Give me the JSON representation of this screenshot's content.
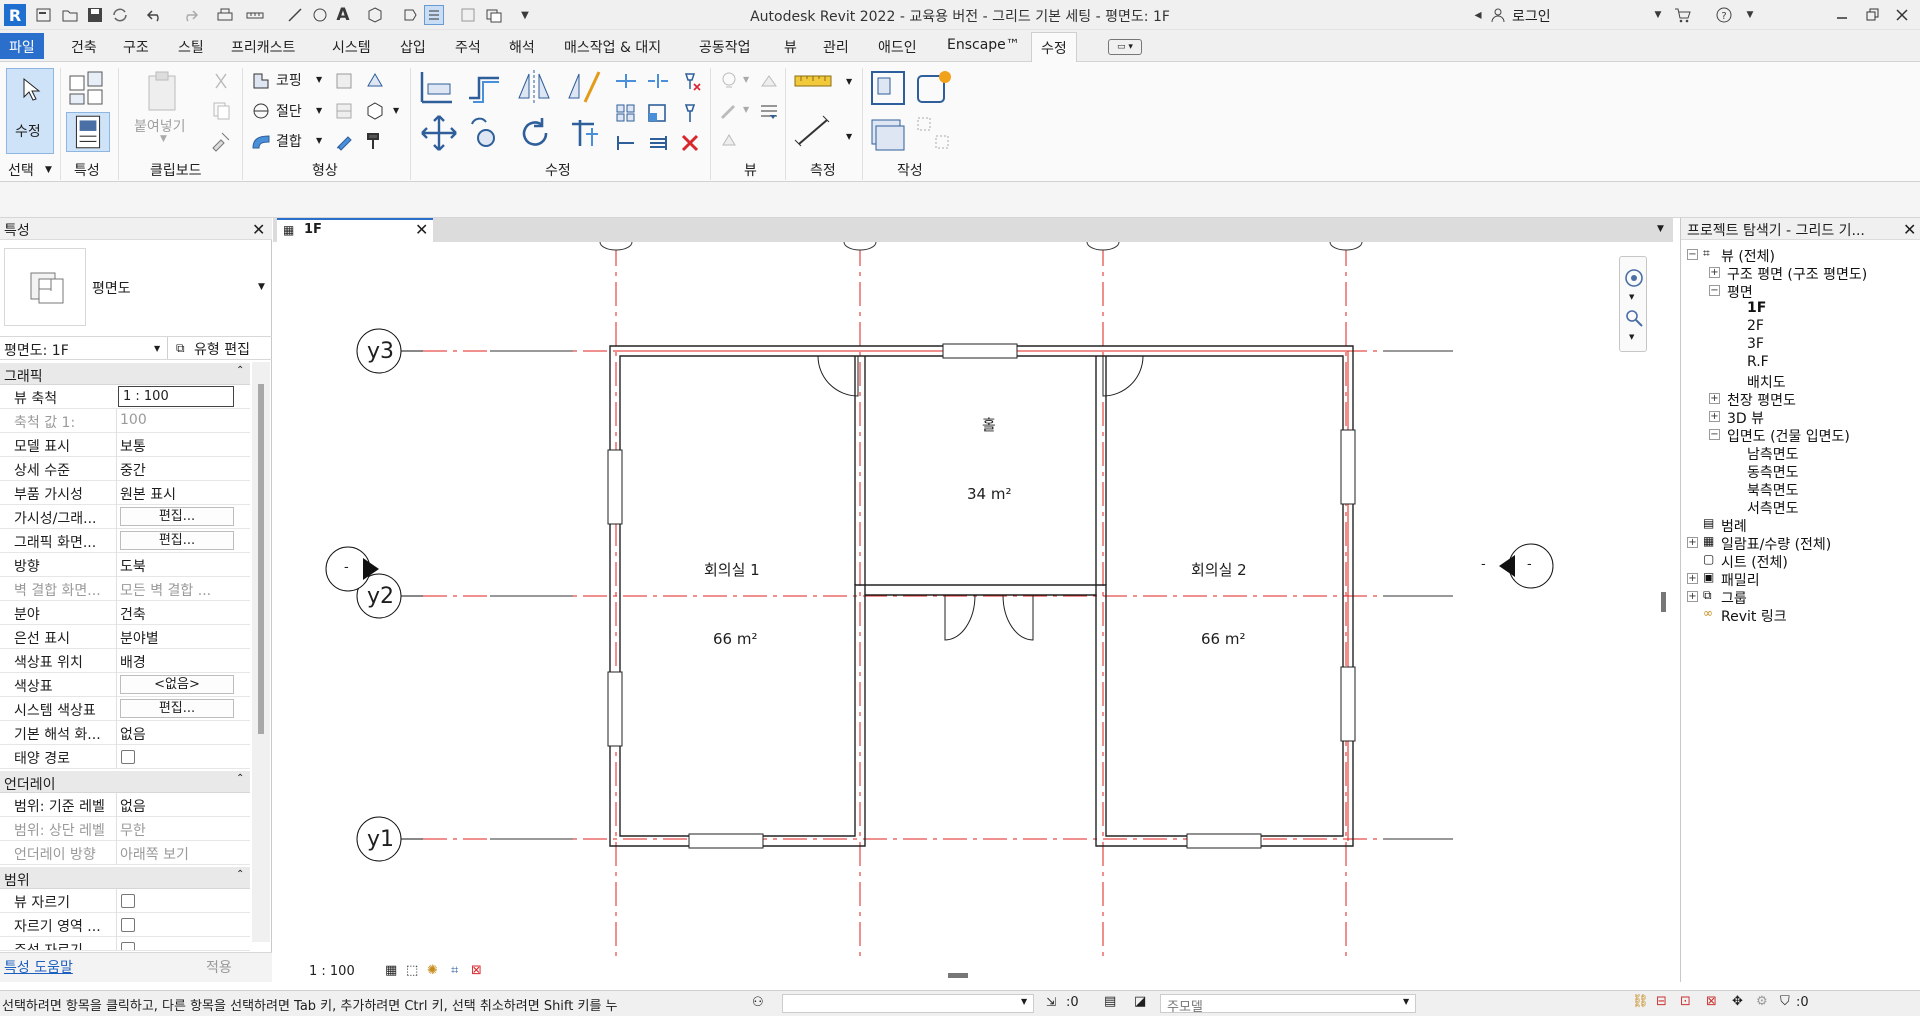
{
  "app": {
    "title": "Autodesk Revit 2022 - 교육용 버전 - 그리드 기본 세팅 - 평면도: 1F",
    "login_label": "로그인",
    "logo_letter": "R"
  },
  "tabs": [
    "파일",
    "건축",
    "구조",
    "스틸",
    "프리캐스트",
    "시스템",
    "삽입",
    "주석",
    "해석",
    "매스작업 & 대지",
    "공동작업",
    "뷰",
    "관리",
    "애드인",
    "Enscape™",
    "수정"
  ],
  "active_tab": "수정",
  "ribbon": {
    "modify_label": "수정",
    "paste_label": "붙여넣기",
    "cope_label": "코핑",
    "cut_label": "절단",
    "join_label": "결합",
    "panels": {
      "select": "선택",
      "properties": "특성",
      "clipboard": "클립보드",
      "geometry": "형상",
      "modify": "수정",
      "view": "뷰",
      "measure": "측정",
      "create": "작성"
    }
  },
  "properties": {
    "title": "특성",
    "type_name": "평면도",
    "instance_selector": "평면도: 1F",
    "edit_type_label": "유형 편집",
    "groups": {
      "graphics": "그래픽",
      "underlay": "언더레이",
      "extents": "범위"
    },
    "rows": {
      "view_scale": {
        "k": "뷰 축척",
        "v": "1 : 100"
      },
      "scale_value": {
        "k": "축척 값    1:",
        "v": "100"
      },
      "model_display": {
        "k": "모델 표시",
        "v": "보통"
      },
      "detail_level": {
        "k": "상세 수준",
        "v": "중간"
      },
      "part_visibility": {
        "k": "부품 가시성",
        "v": "원본 표시"
      },
      "vg_overrides": {
        "k": "가시성/그래...",
        "v": "편집..."
      },
      "graphic_display": {
        "k": "그래픽 화면...",
        "v": "편집..."
      },
      "orientation": {
        "k": "방향",
        "v": "도북"
      },
      "wall_join": {
        "k": "벽 결합 화면...",
        "v": "모든 벽 결합 ..."
      },
      "discipline": {
        "k": "분야",
        "v": "건축"
      },
      "show_hidden": {
        "k": "은선 표시",
        "v": "분야별"
      },
      "color_scheme_location": {
        "k": "색상표 위치",
        "v": "배경"
      },
      "color_scheme": {
        "k": "색상표",
        "v": "<없음>"
      },
      "system_color": {
        "k": "시스템 색상표",
        "v": "편집..."
      },
      "default_analysis": {
        "k": "기본 해석 화...",
        "v": "없음"
      },
      "sun_path": {
        "k": "태양 경로",
        "v": ""
      },
      "range_base": {
        "k": "범위: 기준 레벨",
        "v": "없음"
      },
      "range_top": {
        "k": "범위: 상단 레벨",
        "v": "무한"
      },
      "underlay_orientation": {
        "k": "언더레이 방향",
        "v": "아래쪽 보기"
      },
      "crop_view": {
        "k": "뷰 자르기",
        "v": ""
      },
      "crop_region": {
        "k": "자르기 영역 ...",
        "v": ""
      },
      "annotation_crop": {
        "k": "주석 자르기",
        "v": ""
      }
    },
    "help_link": "특성 도움말",
    "apply_label": "적용"
  },
  "view": {
    "tab_label": "1F",
    "scale": "1 : 100",
    "rooms": [
      {
        "name": "회의실 1",
        "area": "66 m²"
      },
      {
        "name": "홀",
        "area": "34 m²"
      },
      {
        "name": "회의실 2",
        "area": "66 m²"
      }
    ],
    "grids": [
      "y3",
      "y2",
      "y1"
    ],
    "elevation_marker_text": "-"
  },
  "browser": {
    "title": "프로젝트 탐색기 - 그리드 기...",
    "items": {
      "views_all": "뷰 (전체)",
      "structural_plans": "구조 평면 (구조 평면도)",
      "floor_plans": "평면",
      "plan_1f": "1F",
      "plan_2f": "2F",
      "plan_3f": "3F",
      "plan_rf": "R.F",
      "plan_site": "배치도",
      "ceiling_plans": "천장 평면도",
      "views_3d": "3D 뷰",
      "elevations": "입면도 (건물 입면도)",
      "elev_south": "남측면도",
      "elev_east": "동측면도",
      "elev_north": "북측면도",
      "elev_west": "서측면도",
      "legends": "범례",
      "schedules": "일람표/수량 (전체)",
      "sheets": "시트 (전체)",
      "families": "패밀리",
      "groups": "그룹",
      "revit_links": "Revit 링크"
    }
  },
  "status": {
    "message": "선택하려면 항목을 클릭하고, 다른 항목을 선택하려면 Tab 키, 추가하려면 Ctrl 키, 선택 취소하려면 Shift 키를 누",
    "count": ":0",
    "model_combo": "주모델",
    "filter_count": ":0"
  },
  "colors": {
    "accent": "#2a6fcc",
    "grid_line": "#e0211d",
    "ribbon_icon": "#4a6fa5"
  }
}
